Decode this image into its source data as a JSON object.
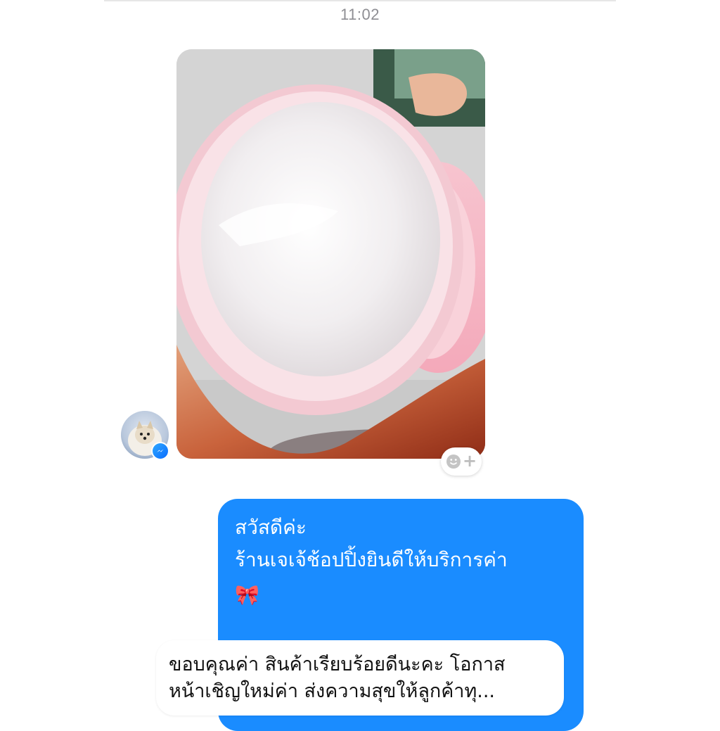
{
  "conversation": {
    "timestamp": "11:02",
    "incoming": {
      "avatar_icon": "dog-avatar-icon",
      "badge_icon": "messenger-icon",
      "attachment_icon": "photo-attachment-icon",
      "reaction_icon": "add-reaction-icon",
      "reaction_plus": "+"
    },
    "outgoing": {
      "line1": "สวัสดีค่ะ",
      "line2": "ร้านเจเจ้ช้อปปิ้งยินดีให้บริการค่า",
      "emoji": "🎀",
      "bubble_color": "#1a8cff"
    }
  },
  "overlay_caption": {
    "line1": "ขอบคุณค่า สินค้าเรียบร้อยดีนะคะ โอกาส",
    "line2": "หน้าเชิญใหม่ค่า ส่งความสุขให้ลูกค้าทุ..."
  }
}
